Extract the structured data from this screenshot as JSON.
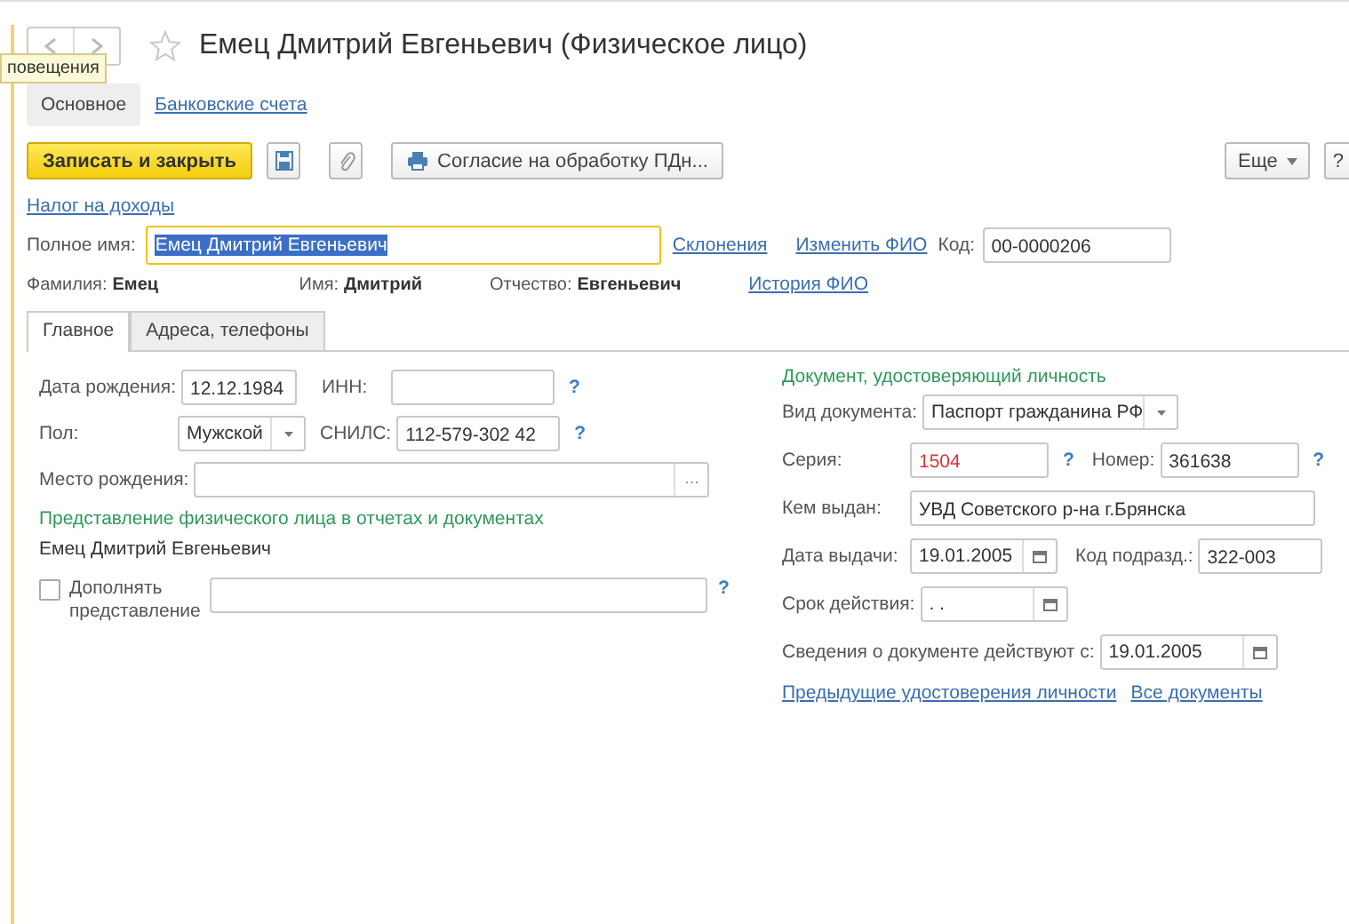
{
  "tooltip": "повещения",
  "title": "Емец Дмитрий Евгеньевич (Физическое лицо)",
  "tabs": [
    {
      "label": "Основное",
      "selected": true
    },
    {
      "label": "Банковские счета",
      "selected": false
    }
  ],
  "toolbar": {
    "primary": "Записать и закрыть",
    "print": "Согласие на обработку ПДн...",
    "more": "Еще",
    "help": "?"
  },
  "tax_link": "Налог на доходы",
  "full_name": {
    "label": "Полное имя:",
    "value": "Емец Дмитрий Евгеньевич",
    "focused": true,
    "declension_link": "Склонения"
  },
  "change_name_link": "Изменить ФИО",
  "code": {
    "label": "Код:",
    "value": "00-0000206"
  },
  "history_link": "История ФИО",
  "name_parts": [
    {
      "label": "Фамилия:",
      "value": "Емец"
    },
    {
      "label": "Имя:",
      "value": "Дмитрий"
    },
    {
      "label": "Отчество:",
      "value": "Евгеньевич"
    }
  ],
  "inner_tabs": [
    {
      "label": "Главное",
      "selected": true
    },
    {
      "label": "Адреса, телефоны",
      "selected": false
    }
  ],
  "left": {
    "rows": [
      {
        "fields": [
          {
            "label": "Дата рождения:",
            "value": "12.12.1984",
            "kind": "text"
          },
          {
            "label": "ИНН:",
            "kind": "text",
            "help": "?"
          }
        ]
      },
      {
        "fields": [
          {
            "label": "Пол:",
            "value": "Мужской",
            "kind": "select"
          },
          {
            "label": "СНИЛС:",
            "value": "112-579-302 42",
            "kind": "text",
            "help": "?"
          }
        ]
      },
      {
        "fields": [
          {
            "label": "Место рождения:",
            "kind": "choice",
            "button": "..."
          }
        ]
      }
    ],
    "heading": "Представление физического лица в отчетах и документах",
    "presentation": "Емец Дмитрий Евгеньевич",
    "supplement": {
      "label": "Дополнять представление",
      "checked": false,
      "help": "?"
    }
  },
  "right": {
    "heading": "Документ, удостоверяющий личность",
    "rows": [
      {
        "fields": [
          {
            "label": "Вид документа:",
            "value": "Паспорт гражданина РФ",
            "kind": "select",
            "warning": false
          }
        ]
      },
      {
        "fields": [
          {
            "label": "Серия:",
            "value": "1504",
            "kind": "text",
            "help": "?",
            "warning": true
          },
          {
            "label": "Номер:",
            "value": "361638",
            "kind": "text",
            "help": "?",
            "warning": false
          }
        ]
      },
      {
        "fields": [
          {
            "label": "Кем выдан:",
            "value": "УВД Советского р-на г.Брянска",
            "kind": "text",
            "warning": false
          }
        ]
      },
      {
        "fields": [
          {
            "label": "Дата выдачи:",
            "value": "19.01.2005",
            "kind": "date",
            "warning": false
          },
          {
            "label": "Код подразд.:",
            "value": "322-003",
            "kind": "text",
            "warning": false
          }
        ]
      },
      {
        "fields": [
          {
            "label": "Срок действия:",
            "value": ". .",
            "kind": "date",
            "warning": false
          }
        ]
      },
      {
        "fields": [
          {
            "label": "Сведения о документе действуют с:",
            "value": "19.01.2005",
            "kind": "date",
            "warning": false
          }
        ]
      }
    ],
    "links": [
      "Предыдущие удостоверения личности",
      "Все документы"
    ]
  }
}
